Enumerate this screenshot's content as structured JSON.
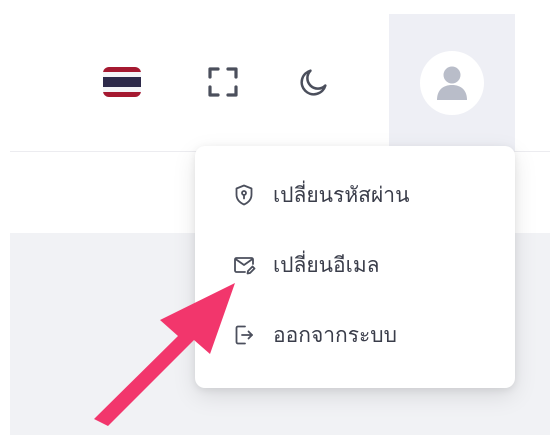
{
  "theme": {
    "icon_color": "#4b4f5c",
    "avatar_bg": "#eeeff5",
    "avatar_icon_color": "#b9bdc9",
    "content_bg": "#f1f2f5",
    "arrow_color": "#f2366c"
  },
  "toolbar": {
    "language_flag": "thailand-flag",
    "fullscreen_icon": "fullscreen-icon",
    "dark_mode_icon": "moon-icon",
    "flag_colors": [
      "#a51931",
      "#f4f5f8",
      "#2d2a4a",
      "#f4f5f8",
      "#a51931"
    ]
  },
  "user_menu": {
    "items": [
      {
        "label": "เปลี่ยนรหัสผ่าน",
        "icon": "shield-key-icon"
      },
      {
        "label": "เปลี่ยนอีเมล",
        "icon": "mail-edit-icon"
      },
      {
        "label": "ออกจากระบบ",
        "icon": "logout-icon"
      }
    ]
  }
}
